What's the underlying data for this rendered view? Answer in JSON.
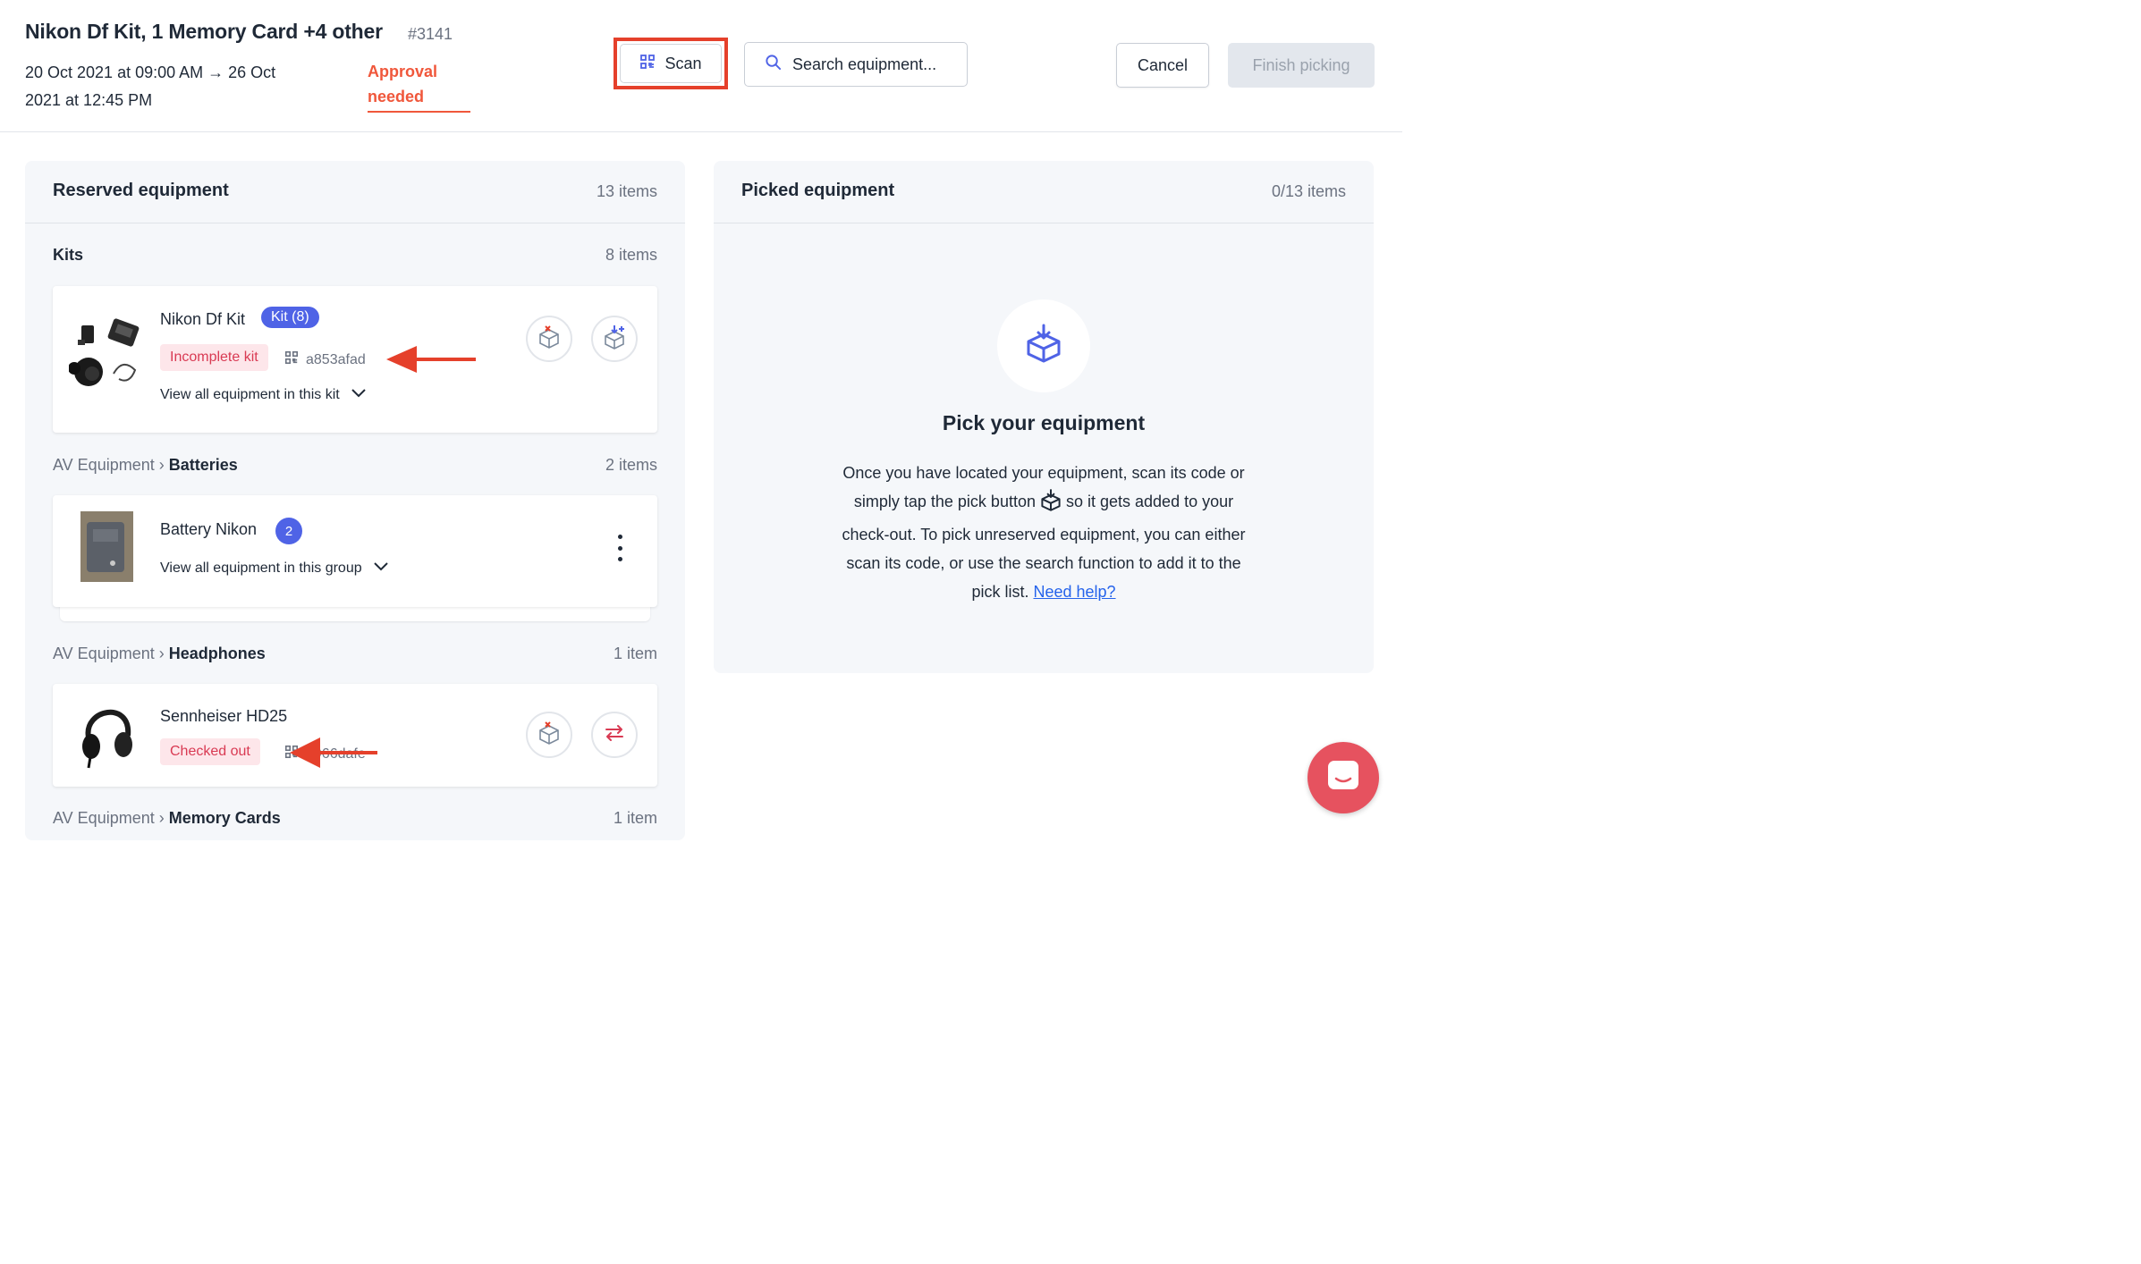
{
  "header": {
    "title": "Nikon Df Kit, 1 Memory Card +4 other",
    "order_number": "#3141",
    "date_range": "20 Oct 2021 at 09:00 AM → 26 Oct 2021 at 12:45 PM",
    "approval_status": "Approval needed",
    "scan_label": "Scan",
    "search_placeholder": "Search equipment...",
    "cancel_label": "Cancel",
    "finish_label": "Finish picking"
  },
  "reserved": {
    "title": "Reserved equipment",
    "count": "13 items",
    "groups": [
      {
        "category": "",
        "name": "Kits",
        "count": "8 items",
        "item": {
          "name": "Nikon Df Kit",
          "badge": "Kit (8)",
          "status": "Incomplete kit",
          "code": "a853afad",
          "view_link": "View all equipment in this kit"
        }
      },
      {
        "category": "AV Equipment ›",
        "name": "Batteries",
        "count": "2 items",
        "item": {
          "name": "Battery Nikon",
          "badge": "2",
          "view_link": "View all equipment in this group"
        }
      },
      {
        "category": "AV Equipment ›",
        "name": "Headphones",
        "count": "1 item",
        "item": {
          "name": "Sennheiser HD25",
          "status": "Checked out",
          "code": "e966dafe"
        }
      },
      {
        "category": "AV Equipment ›",
        "name": "Memory Cards",
        "count": "1 item"
      }
    ]
  },
  "picked": {
    "title": "Picked equipment",
    "count": "0/13 items",
    "empty_title": "Pick your equipment",
    "empty_text_1": "Once you have located your equipment, scan its code or simply tap the pick button",
    "empty_text_2": "so it gets added to your check-out. To pick unreserved equipment, you can either scan its code, or use the search function to add it to the pick list.",
    "help_link": "Need help?"
  },
  "colors": {
    "accent": "#4f63e6",
    "danger": "#d93a53",
    "annotation": "#e5402b",
    "chat": "#e6525f"
  }
}
